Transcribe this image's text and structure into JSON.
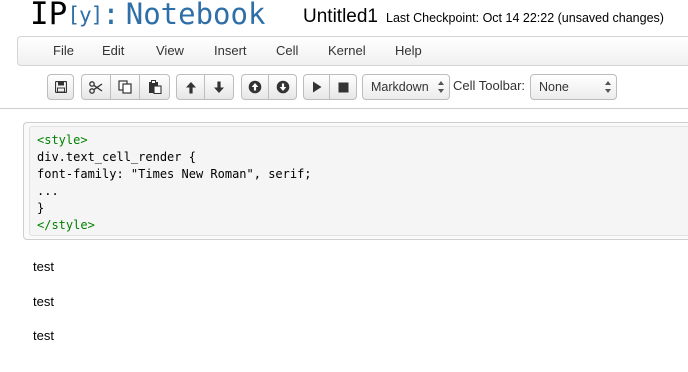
{
  "header": {
    "logo": {
      "ip": "IP",
      "y": "[y]",
      "colon": ":",
      "notebook": "Notebook"
    },
    "notebook_name": "Untitled1",
    "checkpoint": "Last Checkpoint: Oct 14 22:22 (unsaved changes)"
  },
  "menu": {
    "items": [
      {
        "label": "File"
      },
      {
        "label": "Edit"
      },
      {
        "label": "View"
      },
      {
        "label": "Insert"
      },
      {
        "label": "Cell"
      },
      {
        "label": "Kernel"
      },
      {
        "label": "Help"
      }
    ]
  },
  "toolbar": {
    "buttons": [
      {
        "name": "save-button",
        "icon": "save-icon"
      },
      {
        "name": "cut-button",
        "icon": "scissors-icon"
      },
      {
        "name": "copy-button",
        "icon": "copy-icon"
      },
      {
        "name": "paste-button",
        "icon": "paste-icon"
      },
      {
        "name": "move-up-button",
        "icon": "arrow-up-icon"
      },
      {
        "name": "move-down-button",
        "icon": "arrow-down-icon"
      },
      {
        "name": "insert-above-button",
        "icon": "circle-arrow-up-icon"
      },
      {
        "name": "insert-below-button",
        "icon": "circle-arrow-down-icon"
      },
      {
        "name": "run-button",
        "icon": "play-icon"
      },
      {
        "name": "stop-button",
        "icon": "stop-icon"
      }
    ],
    "cell_type": "Markdown",
    "cell_toolbar_label": "Cell Toolbar:",
    "cell_toolbar_value": "None"
  },
  "cell": {
    "lines": [
      {
        "tag": "<style>"
      },
      {
        "text": "div.text_cell_render {"
      },
      {
        "text": "font-family: \"Times New Roman\", serif;"
      },
      {
        "text": "..."
      },
      {
        "text": "}"
      },
      {
        "tag": "</style>"
      }
    ]
  },
  "outputs": [
    "test",
    "test",
    "test"
  ]
}
